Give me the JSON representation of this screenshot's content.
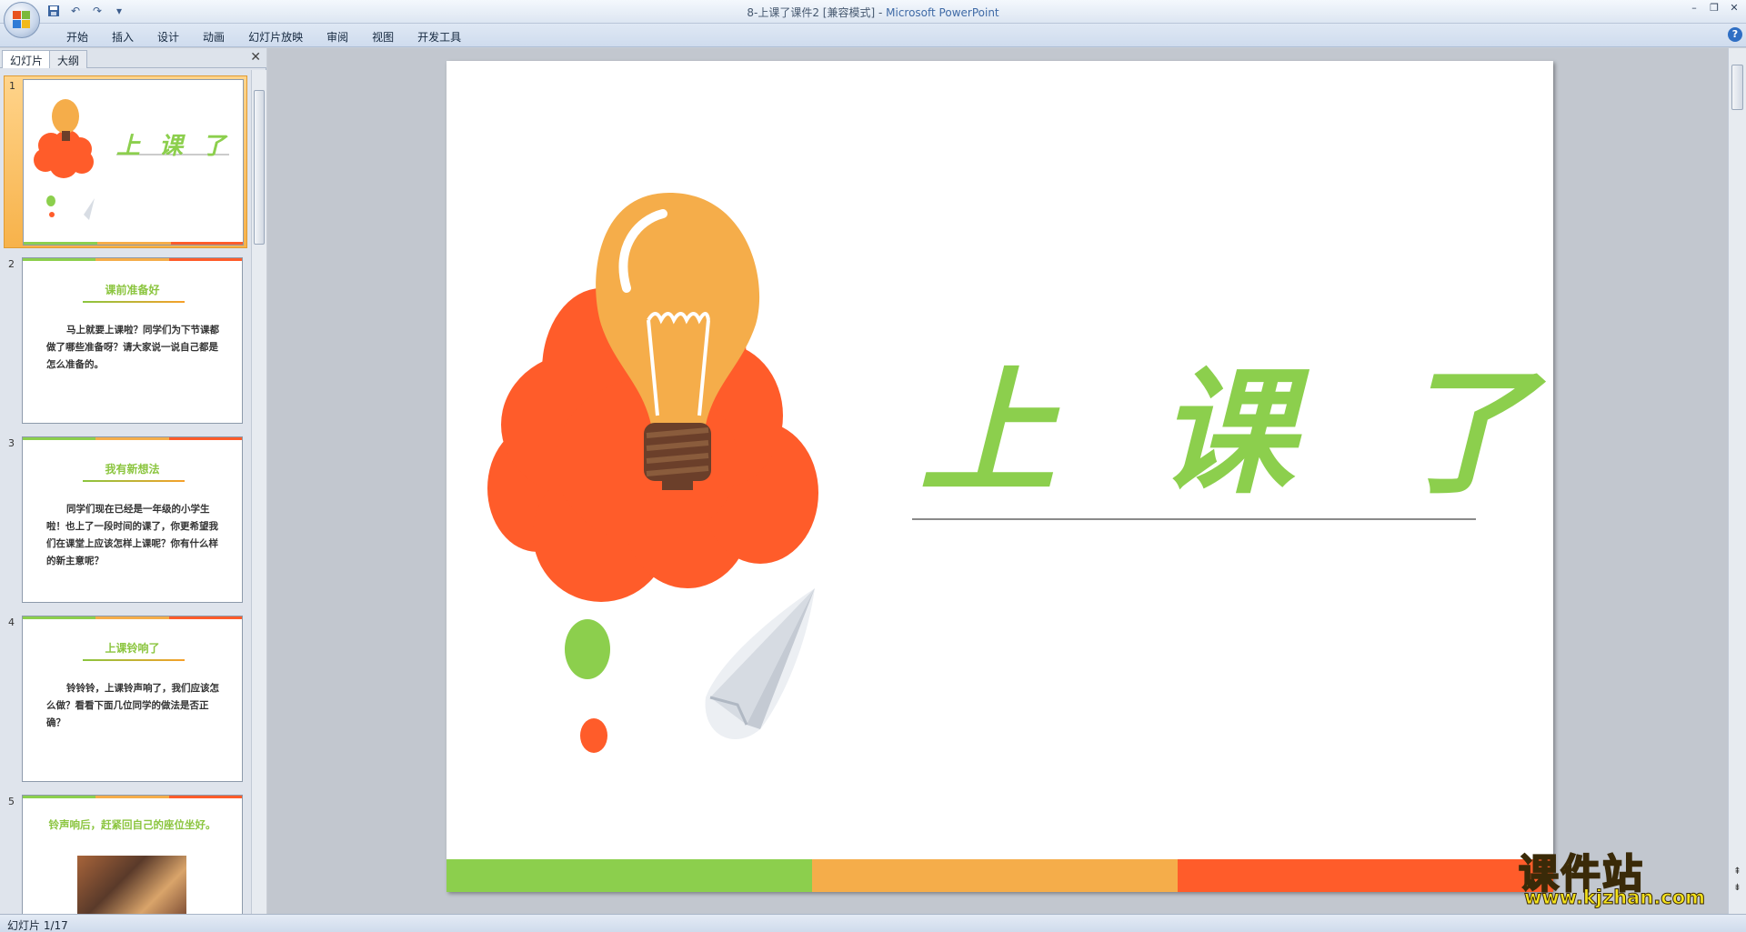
{
  "window": {
    "title": "8-上课了课件2 [兼容模式] - ",
    "app_name": "Microsoft PowerPoint"
  },
  "quick_access": [
    "save-icon",
    "undo-icon",
    "redo-icon",
    "customize-icon"
  ],
  "ribbon": {
    "tabs": [
      "开始",
      "插入",
      "设计",
      "动画",
      "幻灯片放映",
      "审阅",
      "视图",
      "开发工具"
    ]
  },
  "panel": {
    "tabs": [
      "幻灯片",
      "大纲"
    ],
    "slides": [
      {
        "num": "1",
        "title": "上 课 了"
      },
      {
        "num": "2",
        "title": "课前准备好",
        "body": "马上就要上课啦？同学们为下节课都做了哪些准备呀？请大家说一说自己都是怎么准备的。"
      },
      {
        "num": "3",
        "title": "我有新想法",
        "body": "同学们现在已经是一年级的小学生啦！也上了一段时间的课了，你更希望我们在课堂上应该怎样上课呢？你有什么样的新主意呢？"
      },
      {
        "num": "4",
        "title": "上课铃响了",
        "body": "铃铃铃，上课铃声响了，我们应该怎么做？看看下面几位同学的做法是否正确？"
      },
      {
        "num": "5",
        "title": "铃声响后，赶紧回自己的座位坐好。"
      }
    ]
  },
  "slide": {
    "title": "上 课 了"
  },
  "colors": {
    "green": "#8ccf4d",
    "orange": "#f5ad4a",
    "red_orange": "#ff5c2a"
  },
  "status": {
    "slide_indicator": "幻灯片 1/17"
  },
  "watermark": {
    "cn": "课件站",
    "url": "www.kjzhan.com"
  }
}
